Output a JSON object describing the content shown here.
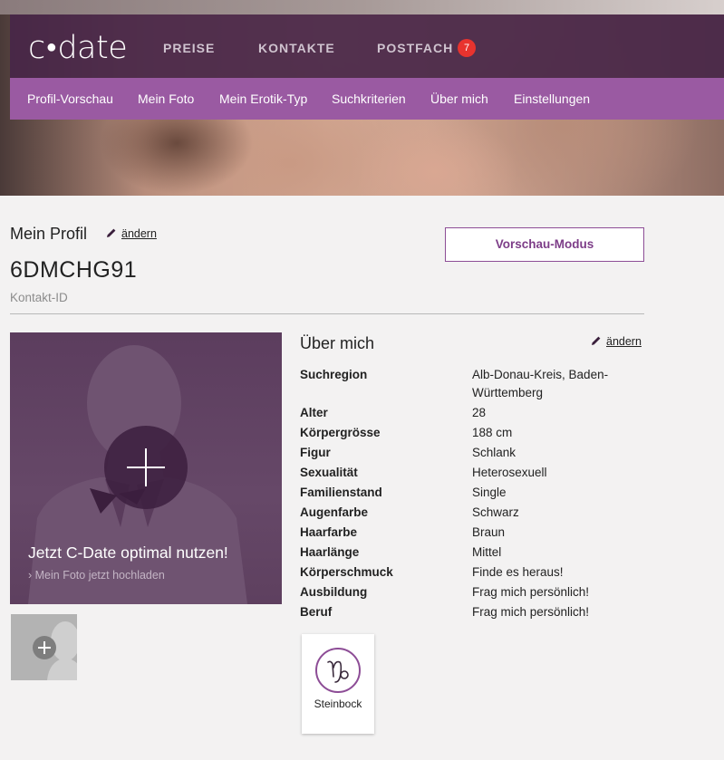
{
  "header": {
    "logo": "c·date",
    "nav": {
      "preise": "PREISE",
      "kontakte": "KONTAKTE",
      "postfach": "POSTFACH",
      "postfach_badge": "7"
    }
  },
  "subnav": {
    "items": [
      "Profil-Vorschau",
      "Mein Foto",
      "Mein Erotik-Typ",
      "Suchkriterien",
      "Über mich",
      "Einstellungen"
    ]
  },
  "profile": {
    "title": "Mein Profil",
    "edit_label": "ändern",
    "preview_button": "Vorschau-Modus",
    "contact_id": "6DMCHG91",
    "contact_id_label": "Kontakt-ID"
  },
  "photo": {
    "cta": "Jetzt C-Date optimal nutzen!",
    "upload_link": "Mein Foto jetzt hochladen"
  },
  "about": {
    "title": "Über mich",
    "edit_label": "ändern",
    "rows": [
      {
        "label": "Suchregion",
        "value": "Alb-Donau-Kreis, Baden-Württemberg"
      },
      {
        "label": "Alter",
        "value": "28"
      },
      {
        "label": "Körpergrösse",
        "value": "188 cm"
      },
      {
        "label": "Figur",
        "value": "Schlank"
      },
      {
        "label": "Sexualität",
        "value": "Heterosexuell"
      },
      {
        "label": "Familienstand",
        "value": "Single"
      },
      {
        "label": "Augenfarbe",
        "value": "Schwarz"
      },
      {
        "label": "Haarfarbe",
        "value": "Braun"
      },
      {
        "label": "Haarlänge",
        "value": "Mittel"
      },
      {
        "label": "Körperschmuck",
        "value": "Finde es heraus!"
      },
      {
        "label": "Ausbildung",
        "value": "Frag mich persönlich!"
      },
      {
        "label": "Beruf",
        "value": "Frag mich persönlich!"
      }
    ]
  },
  "zodiac": {
    "label": "Steinbock",
    "icon": "capricorn-icon"
  },
  "colors": {
    "brand_dark": "#482648",
    "brand_purple": "#9a5aa2",
    "badge_red": "#e8332e",
    "accent": "#8d4d96"
  }
}
